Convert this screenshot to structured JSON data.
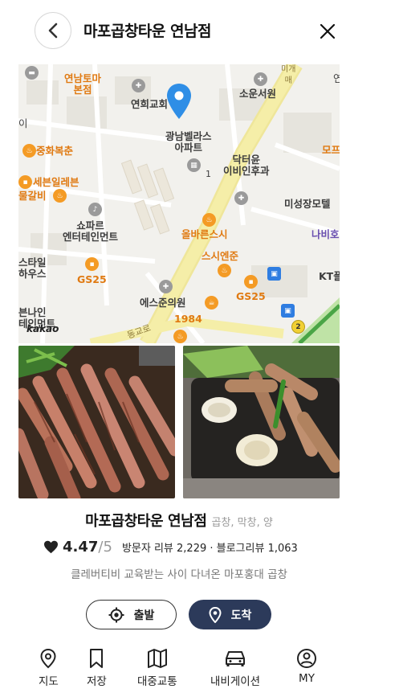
{
  "header": {
    "title": "마포곱창타운 연남점"
  },
  "map": {
    "attribution": "kakao",
    "labels": {
      "yeonnam_toma": "연남토마\n본점",
      "yeonhui_church": "연희교회",
      "soun_church": "소운서원",
      "gwangnam": "광남벨라스\n아파트",
      "junghwa": "중화복춘",
      "seven": "세븐일레븐",
      "galbi": "물갈비",
      "dr_yoon": "닥터윤\n이비인후과",
      "misung": "미성장모텔",
      "show_party": "쇼파르\n엔터테인먼트",
      "olbareun": "올바른스시",
      "nabiho": "나비호",
      "style": "스타일\n하우스",
      "gs25_a": "GS25",
      "sushi_enjun": "스시엔준",
      "kt": "KT플",
      "esjun": "에스준의원",
      "gs25_b": "GS25",
      "bunain": "븐나인\n테인먼트",
      "n1984": "1984",
      "dongkyo": "동교로",
      "mo": "모프",
      "num1": "1",
      "num2": "2",
      "top_n": "연",
      "road_top": "미개\n매",
      "left_i": "이"
    }
  },
  "place": {
    "name": "마포곱창타운 연남점",
    "category": "곱창, 막창, 양",
    "rating": "4.47",
    "rating_max": "/5",
    "reviews": "방문자 리뷰 2,229 · 블로그리뷰 1,063",
    "description": "클레버티비 교육받는 사이 다녀온 마포홍대 곱창"
  },
  "actions": {
    "start": "출발",
    "arrive": "도착"
  },
  "nav": {
    "map": "지도",
    "save": "저장",
    "transit": "대중교통",
    "navigation": "내비게이션",
    "my": "MY"
  },
  "colors": {
    "arrive_button": "#2c3a5a",
    "pin": "#2f8ee6",
    "major_road": "#f5eea8"
  }
}
